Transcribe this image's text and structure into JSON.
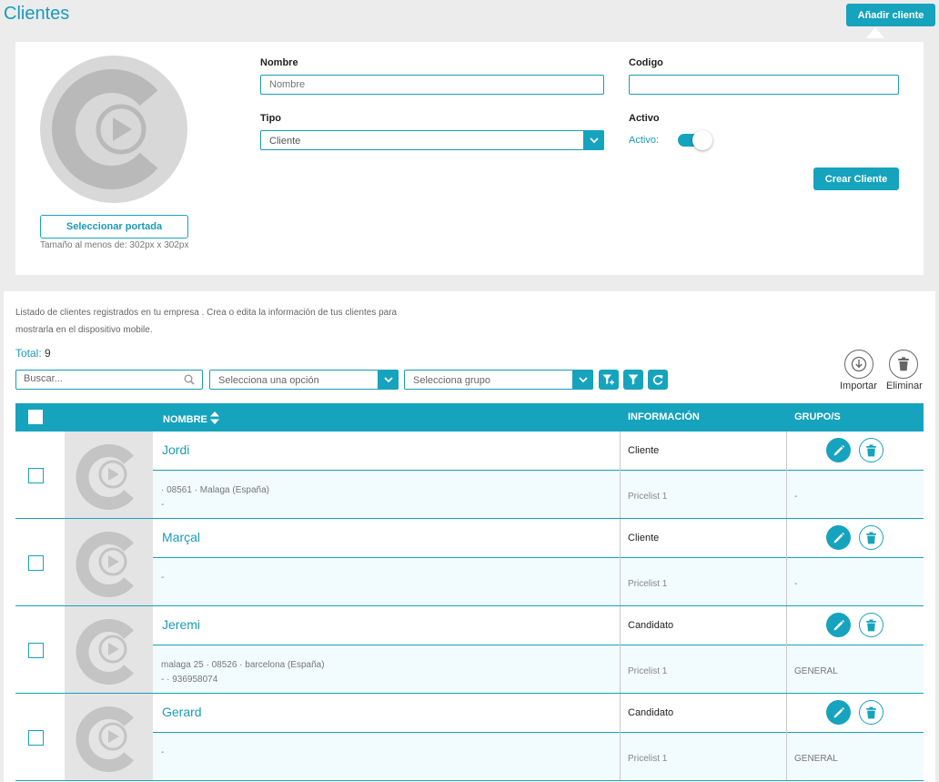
{
  "header": {
    "title": "Clientes",
    "add_button": "Añadir cliente"
  },
  "form": {
    "select_cover_button": "Seleccionar portada",
    "cover_hint": "Tamaño al menos de: 302px x 302px",
    "nombre_label": "Nombre",
    "nombre_placeholder": "Nombre",
    "codigo_label": "Codigo",
    "codigo_value": "",
    "tipo_label": "Tipo",
    "tipo_value": "Cliente",
    "activo_label": "Activo",
    "activo_toggle_label": "Activo:",
    "activo_on": true,
    "create_button": "Crear Cliente"
  },
  "list": {
    "description": "Listado de clientes registrados en tu empresa . Crea o edita la información de tus clientes para mostrarla en el dispositivo mobile.",
    "total_label": "Total:",
    "total_value": "9",
    "search_placeholder": "Buscar...",
    "option_select": "Selecciona una opción",
    "group_select": "Selecciona grupo",
    "import_label": "Importar",
    "delete_label": "Eliminar",
    "columns": {
      "nombre": "NOMBRE",
      "informacion": "INFORMACIÓN",
      "grupos": "GRUPO/S"
    },
    "rows": [
      {
        "name": "Jordi",
        "tipo": "Cliente",
        "addr1": "· 08561 · Malaga (España)",
        "addr2": "-",
        "pricelist": "Pricelist 1",
        "grupo": "-"
      },
      {
        "name": "Marçal",
        "tipo": "Cliente",
        "addr1": "",
        "addr2": "-",
        "pricelist": "Pricelist 1",
        "grupo": "-"
      },
      {
        "name": "Jeremi",
        "tipo": "Candidato",
        "addr1": "malaga 25 · 08526 · barcelona (España)",
        "addr2": "- · 936958074",
        "pricelist": "Pricelist 1",
        "grupo": "GENERAL"
      },
      {
        "name": "Gerard",
        "tipo": "Candidato",
        "addr1": "",
        "addr2": "-",
        "pricelist": "Pricelist 1",
        "grupo": "GENERAL"
      }
    ]
  },
  "colors": {
    "accent": "#16a3bd",
    "title": "#1a9bb8",
    "placeholder_logo": "#b9b9b9"
  }
}
